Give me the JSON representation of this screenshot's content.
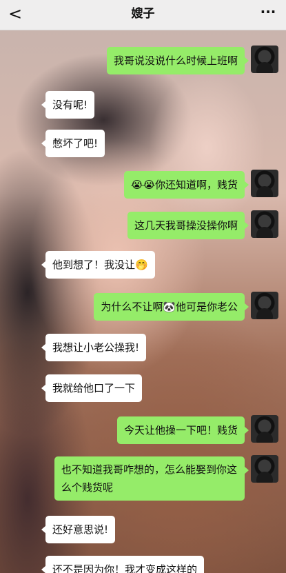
{
  "header": {
    "title": "嫂子",
    "back_icon": "chevron-left-icon",
    "more_icon": "more-dots-icon",
    "back_glyph": "<",
    "more_glyph": "···"
  },
  "colors": {
    "outgoing_bubble": "#95ec69",
    "incoming_bubble": "#ffffff",
    "header_bg": "#efeeee"
  },
  "messages": [
    {
      "side": "right",
      "text": "我哥说没说什么时候上班啊"
    },
    {
      "side": "left",
      "text": "没有呢!"
    },
    {
      "side": "left",
      "text": "憋坏了吧!"
    },
    {
      "side": "right",
      "text": "😭😭你还知道啊，贱货"
    },
    {
      "side": "right",
      "text": "这几天我哥操没操你啊"
    },
    {
      "side": "left",
      "text": "他到想了！我没让🤭"
    },
    {
      "side": "right",
      "text": "为什么不让啊🐼他可是你老公"
    },
    {
      "side": "left",
      "text": "我想让小老公操我!"
    },
    {
      "side": "left",
      "text": "我就给他口了一下"
    },
    {
      "side": "right",
      "text": "今天让他操一下吧！贱货"
    },
    {
      "side": "right",
      "text": "也不知道我哥咋想的，怎么能娶到你这么个贱货呢"
    },
    {
      "side": "left",
      "text": "还好意思说!"
    },
    {
      "side": "left",
      "text": "还不是因为你！我才变成这样的"
    }
  ]
}
